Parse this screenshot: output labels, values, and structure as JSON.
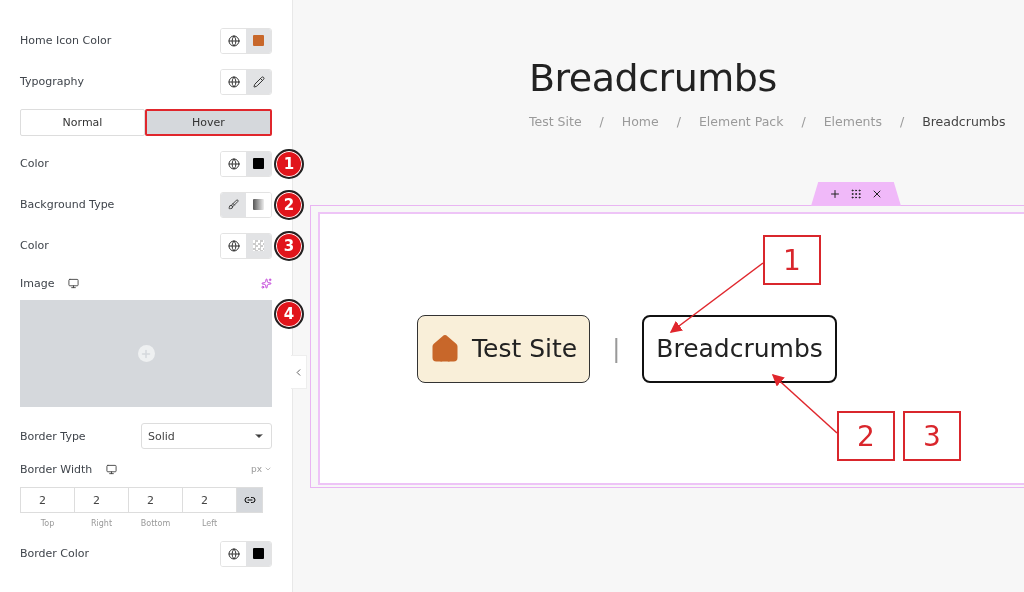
{
  "panel": {
    "controls": [
      {
        "kind": "color",
        "label": "Home Icon Color",
        "color": "#c8672a"
      },
      {
        "kind": "typography",
        "label": "Typography"
      },
      {
        "kind": "tabs",
        "tabs": [
          {
            "label": "Normal",
            "selected": false
          },
          {
            "label": "Hover",
            "selected": true
          }
        ]
      },
      {
        "kind": "color",
        "label": "Color",
        "color": "#000000",
        "marker": "1"
      },
      {
        "kind": "background",
        "label": "Background Type",
        "options": [
          {
            "selected": true
          },
          {
            "selected": false
          }
        ],
        "marker": "2"
      },
      {
        "kind": "empty-color",
        "label": "Color",
        "marker": "3"
      },
      {
        "kind": "image",
        "label": "Image",
        "marker": "4"
      },
      {
        "kind": "select",
        "label": "Border Type",
        "value": "Solid"
      },
      {
        "kind": "dimensions",
        "label": "Border Width",
        "unit": "px",
        "fields": [
          {
            "value": "2",
            "label": "Top"
          },
          {
            "value": "2",
            "label": "Right"
          },
          {
            "value": "2",
            "label": "Bottom"
          },
          {
            "value": "2",
            "label": "Left"
          }
        ]
      },
      {
        "kind": "color",
        "label": "Border Color",
        "color": "#000000"
      }
    ]
  },
  "canvas": {
    "title": "Breadcrumbs",
    "trail": [
      {
        "label": "Test Site"
      },
      {
        "label": "Home"
      },
      {
        "label": "Element Pack"
      },
      {
        "label": "Elements"
      },
      {
        "label": "Breadcrumbs"
      }
    ],
    "trail_separators": [
      "/",
      "/",
      "/",
      "/"
    ],
    "widget": {
      "items": [
        {
          "kind": "home",
          "label": "Test Site"
        },
        {
          "kind": "current",
          "label": "Breadcrumbs"
        }
      ],
      "separator": "|"
    },
    "callouts": [
      {
        "label": "1"
      },
      {
        "label": "2"
      },
      {
        "label": "3"
      }
    ]
  }
}
